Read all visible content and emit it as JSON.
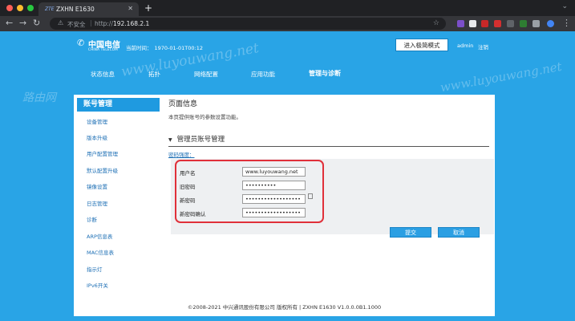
{
  "browser": {
    "tab_title": "ZXHN E1630",
    "tab_favicon_text": "ZTE",
    "security_label": "不安全",
    "url_protocol": "http://",
    "url_host": "192.168.2.1"
  },
  "header": {
    "logo_cn": "中国电信",
    "logo_en": "CHINA TELECOM",
    "time_label": "当前时间：",
    "time_value": "1970-01-01T00:12",
    "advanced_mode_button": "进入极简模式",
    "username": "admin",
    "logout": "注销"
  },
  "nav": {
    "items": [
      "状态信息",
      "拓扑",
      "网络配置",
      "应用功能",
      "管理与诊断"
    ],
    "active_index": 4
  },
  "watermark": {
    "url": "www.luyouwang.net",
    "brand": "路由网"
  },
  "sidebar": {
    "title": "账号管理",
    "items": [
      "设备管理",
      "版本升级",
      "用户配置管理",
      "默认配置升级",
      "镜像设置",
      "日志管理",
      "诊断",
      "ARP信息表",
      "MAC信息表",
      "指示灯",
      "IPv6开关"
    ]
  },
  "content": {
    "page_info_title": "页面信息",
    "page_info_desc": "本页提供账号的参数设置功能。",
    "section_title": "管理员账号管理",
    "password_strength_link": "密码强度：",
    "form": {
      "username_label": "用户名",
      "username_value": "www.luyouwang.net",
      "old_password_label": "旧密码",
      "old_password_value": "••••••••••",
      "new_password_label": "新密码",
      "new_password_value": "••••••••••••••••••",
      "confirm_password_label": "新密码确认",
      "confirm_password_value": "••••••••••••••••••"
    },
    "submit_button": "提交",
    "cancel_button": "取消"
  },
  "footer": {
    "copyright": "©2008-2021 中兴通讯股份有限公司 版权所有  |  ZXHN E1630 V1.0.0.0B1.1000"
  },
  "colors": {
    "page_blue": "#29a4e6",
    "button_blue": "#2b9fe3",
    "highlight_red": "#e0303a",
    "link_blue": "#1d6fb5"
  }
}
